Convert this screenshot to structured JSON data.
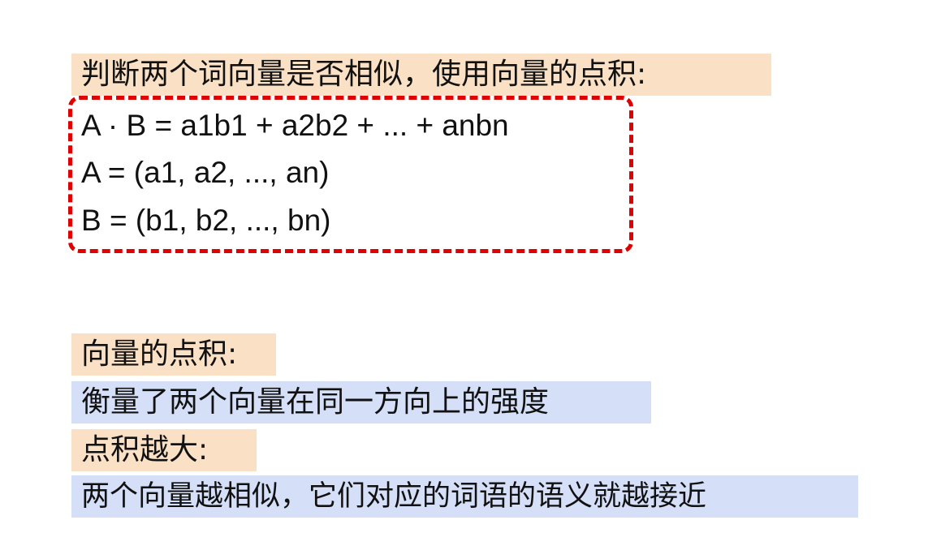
{
  "section1": {
    "heading": "判断两个词向量是否相似，使用向量的点积:",
    "formulas": [
      "A · B = a1b1 + a2b2 + ... + anbn",
      "A = (a1, a2, ..., an)",
      "B = (b1, b2, ..., bn)"
    ]
  },
  "section2": {
    "heading": "向量的点积:",
    "description": "衡量了两个向量在同一方向上的强度"
  },
  "section3": {
    "heading": "点积越大:",
    "description": "两个向量越相似，它们对应的词语的语义就越接近"
  },
  "colors": {
    "orange_highlight": "#fae0c4",
    "blue_highlight": "#d6dff8",
    "dashed_border": "#e00000"
  }
}
